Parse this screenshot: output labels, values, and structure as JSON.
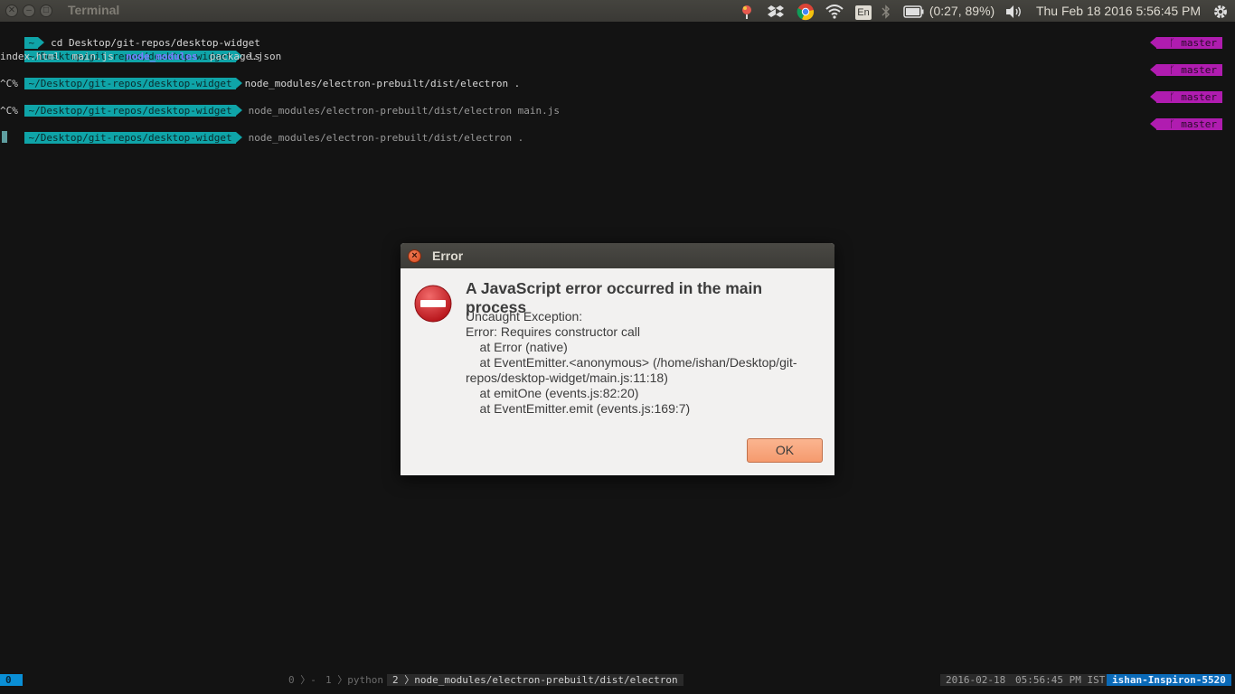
{
  "window": {
    "title": "Terminal"
  },
  "panel": {
    "battery": "(0:27, 89%)",
    "keyboard": "En",
    "datetime": "Thu Feb 18 2016  5:56:45 PM",
    "icons": [
      "weather-icon",
      "dropbox-icon",
      "chrome-icon",
      "wifi-icon",
      "keyboard-layout-icon",
      "bluetooth-icon",
      "battery-icon",
      "volume-icon",
      "settings-gear-icon"
    ]
  },
  "terminal": {
    "lines": [
      {
        "prompt": "~",
        "command": "cd Desktop/git-repos/desktop-widget"
      },
      {
        "prompt": "~/Desktop/git-repos/desktop-widget",
        "command": "ls",
        "branch": "master"
      },
      {
        "ls_files": [
          "index.html",
          "main.js",
          "node_modules",
          "package.json"
        ]
      },
      {
        "prompt": "~/Desktop/git-repos/desktop-widget",
        "command": "node_modules/electron-prebuilt/dist/electron .",
        "branch": "master"
      },
      {
        "text": "^C%"
      },
      {
        "prompt": "~/Desktop/git-repos/desktop-widget",
        "command": "node_modules/electron-prebuilt/dist/electron main.js",
        "branch": "master"
      },
      {
        "text": "^C%"
      },
      {
        "prompt": "~/Desktop/git-repos/desktop-widget",
        "command": "node_modules/electron-prebuilt/dist/electron .",
        "branch": "master"
      }
    ]
  },
  "statusline": {
    "session": "0",
    "win0": "0",
    "win0_name": "-",
    "win1": "1",
    "win1_name": "python",
    "win2": "2",
    "win2_name": "node_modules/electron-prebuilt/dist/electron",
    "date": "2016-02-18",
    "time": "05:56:45 PM IST",
    "host": "ishan-Inspiron-5520"
  },
  "dialog": {
    "title": "Error",
    "heading": "A JavaScript error occurred in the main process",
    "body_lines": [
      "Uncaught Exception:",
      "Error: Requires constructor call",
      "    at Error (native)",
      "    at EventEmitter.<anonymous> (/home/ishan/Desktop/git-",
      "repos/desktop-widget/main.js:11:18)",
      "    at emitOne (events.js:82:20)",
      "    at EventEmitter.emit (events.js:169:7)"
    ],
    "ok_label": "OK"
  },
  "colors": {
    "prompt_bg": "#0fa4a8",
    "branch_bg": "#b01cb0",
    "terminal_bg": "#131313",
    "ok_button": "#f59a6e",
    "error_icon": "#d7282f"
  }
}
